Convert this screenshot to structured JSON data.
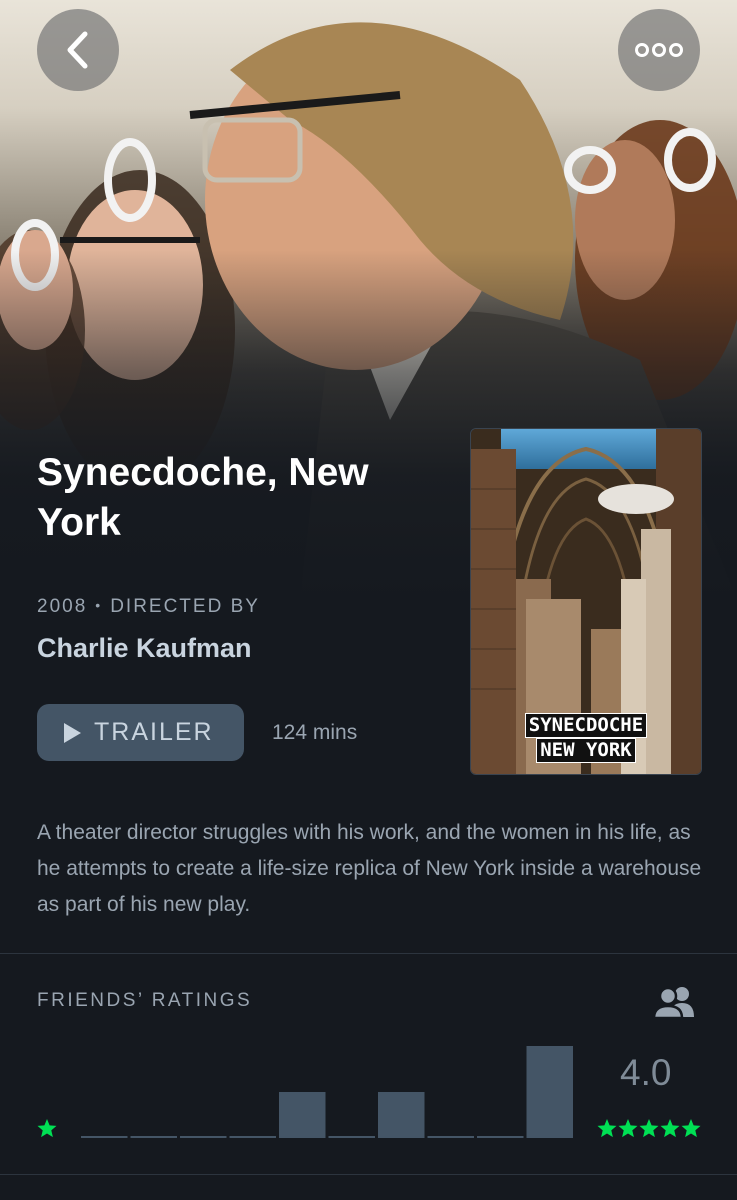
{
  "header": {
    "back_icon": "chevron-left-icon",
    "more_icon": "more-horizontal-icon"
  },
  "film": {
    "title": "Synecdoche, New York",
    "year": "2008",
    "directed_by_label": "DIRECTED BY",
    "director": "Charlie Kaufman",
    "trailer_label": "TRAILER",
    "trailer_icon": "play-icon",
    "runtime": "124 mins",
    "poster_title_line1": "SYNECDOCHE",
    "poster_title_line2": "NEW YORK",
    "synopsis": "A theater director struggles with his work, and the women in his life, as he attempts to create a life-size replica of New York inside a warehouse as part of his new play."
  },
  "ratings": {
    "label": "FRIENDS’ RATINGS",
    "friends_icon": "people-icon",
    "average": "4.0",
    "min_star_icon": "star-icon",
    "max_stars_icon": "five-stars-icon",
    "star_color": "#00e054",
    "bar_color": "#445566",
    "histogram_relative_counts": [
      0,
      0,
      0,
      0,
      1,
      0,
      1,
      0,
      0,
      2
    ]
  },
  "colors": {
    "background": "#15191f",
    "muted_text": "#9aa5b1",
    "button_bg": "#445566"
  }
}
